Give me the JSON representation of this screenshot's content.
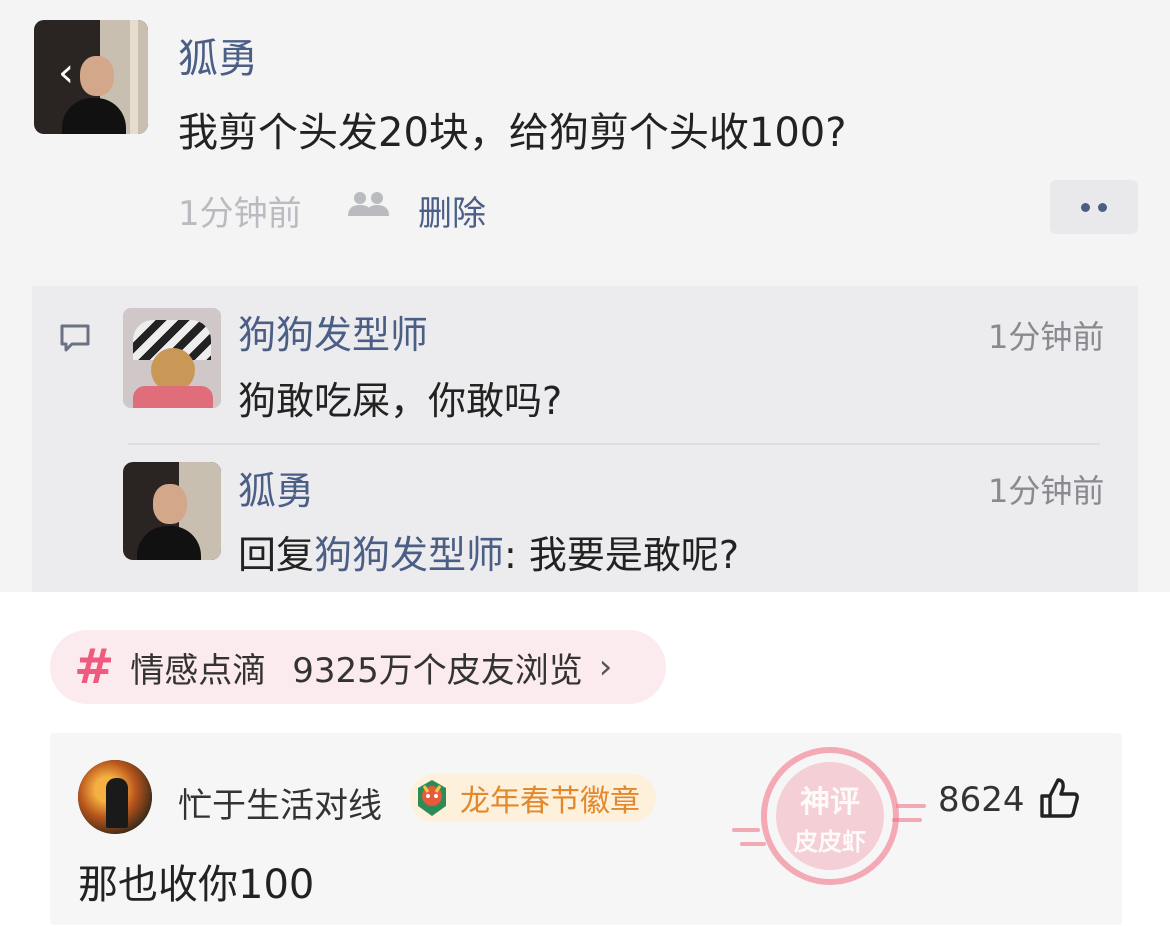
{
  "post": {
    "author": "狐勇",
    "text": "我剪个头发20块，给狗剪个头收100?",
    "time": "1分钟前",
    "delete_label": "删除",
    "more_icon": "more-dots-icon",
    "people_icon": "people-icon"
  },
  "comments": [
    {
      "name": "狗狗发型师",
      "time": "1分钟前",
      "text": "狗敢吃屎，你敢吗?"
    },
    {
      "name": "狐勇",
      "time": "1分钟前",
      "reply_prefix": "回复",
      "reply_to": "狗狗发型师",
      "reply_text": ": 我要是敢呢?"
    }
  ],
  "topic": {
    "hash": "#",
    "name": "情感点滴",
    "views": "9325万个皮友浏览",
    "chevron": "›"
  },
  "hot_comment": {
    "user": "忙于生活对线",
    "badge": "龙年春节徽章",
    "likes": "8624",
    "text": "那也收你100"
  },
  "watermark": {
    "line1": "神评",
    "line2": "皮皮虾"
  },
  "colors": {
    "link": "#4b5e86",
    "hash": "#f05a7e",
    "badge_text": "#e3882d",
    "watermark": "#f06b7f"
  }
}
